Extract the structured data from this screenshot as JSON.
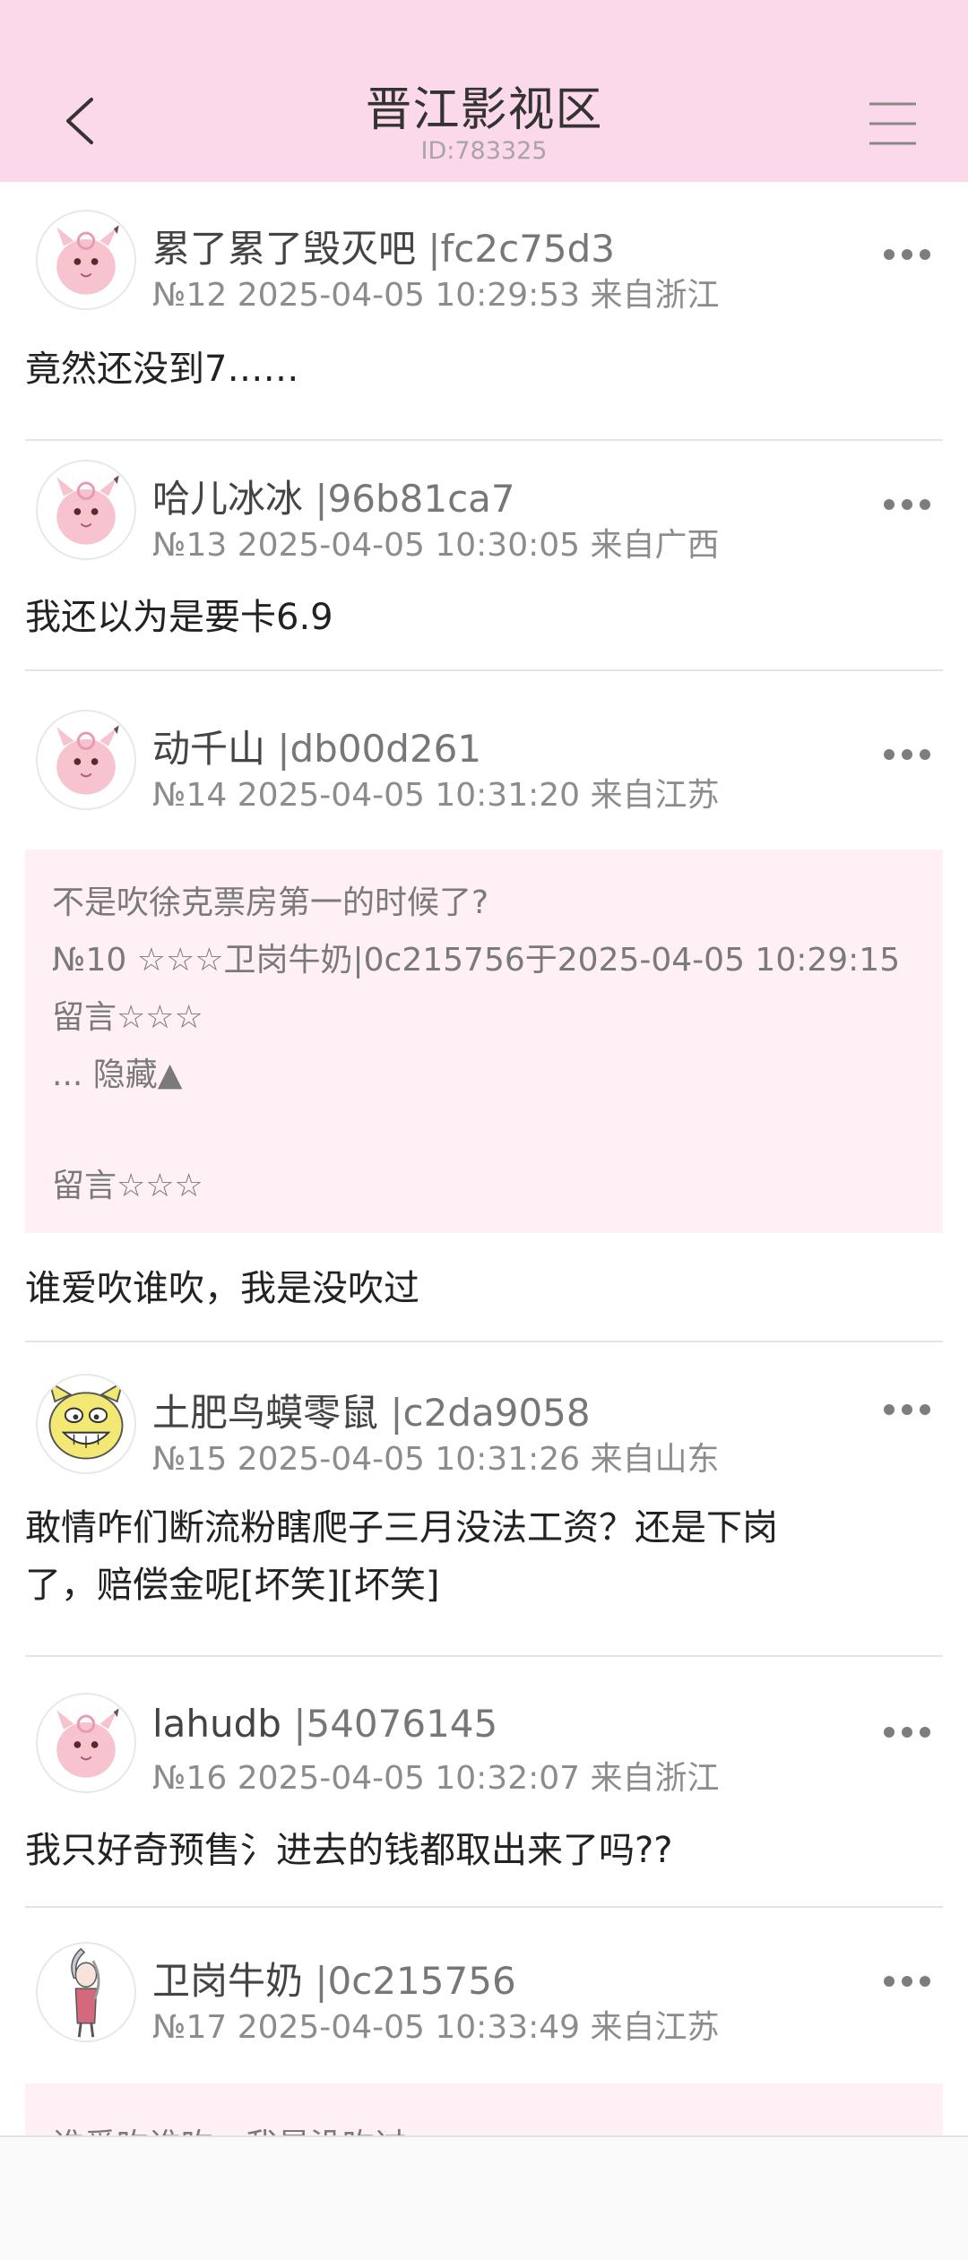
{
  "header": {
    "title": "晋江影视区",
    "subtitle": "ID:783325",
    "back_icon": "chevron-left-icon",
    "menu_icon": "hamburger-menu-icon",
    "background": "#fcd9ea"
  },
  "posts": [
    {
      "username": "累了累了毁灭吧",
      "uid": " |fc2c75d3",
      "meta": "№12 2025-04-05 10:29:53 来自浙江",
      "content": "竟然还没到7……",
      "avatar": "pink-clefairy-avatar"
    },
    {
      "username": "哈儿冰冰",
      "uid": " |96b81ca7",
      "meta": "№13 2025-04-05 10:30:05 来自广西",
      "content": "我还以为是要卡6.9",
      "avatar": "pink-clefairy-avatar"
    },
    {
      "username": "动千山",
      "uid": " |db00d261",
      "meta": "№14 2025-04-05 10:31:20 来自江苏",
      "quote": [
        "不是吹徐克票房第一的时候了?",
        "№10 ☆☆☆卫岗牛奶|0c215756于2025-04-05 10:29:15",
        "留言☆☆☆",
        "... 隐藏▲",
        "留言☆☆☆"
      ],
      "content": "谁爱吹谁吹，我是没吹过",
      "avatar": "pink-clefairy-avatar"
    },
    {
      "username": "土肥鸟蟆零鼠",
      "uid": " |c2da9058",
      "meta": "№15 2025-04-05 10:31:26 来自山东",
      "content_lines": [
        "敢情咋们断流粉瞎爬子三月没法工资？还是下岗",
        "了，赔偿金呢[坏笑][坏笑]"
      ],
      "avatar": "yellow-cat-face-avatar"
    },
    {
      "username": "lahudb",
      "uid": " |54076145",
      "meta": "№16 2025-04-05 10:32:07 来自浙江",
      "content": "我只好奇预售氵进去的钱都取出来了吗??",
      "avatar": "pink-clefairy-avatar"
    },
    {
      "username": "卫岗牛奶",
      "uid": " |0c215756",
      "meta": "№17 2025-04-05 10:33:49 来自江苏",
      "quote_partial": "谁爱吹谁吹，我是没吹过",
      "avatar": "anime-character-avatar"
    }
  ],
  "more_icon": "more-dots-icon",
  "colors": {
    "quote_bg": "#fff0f6",
    "divider": "#e4e4e4"
  }
}
